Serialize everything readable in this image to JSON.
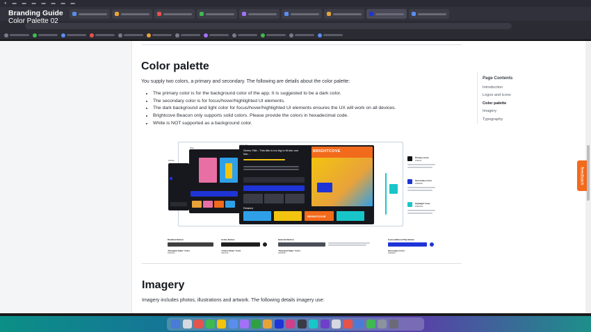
{
  "overlay": {
    "title": "Branding Guide",
    "subtitle": "Color Palette 02"
  },
  "colors": {
    "primary_dark": "#111111",
    "secondary_blue": "#1E34D6",
    "highlight_cyan": "#18C6C9",
    "brightcove_orange": "#F26A1B",
    "feedback_orange": "#F26A1B"
  },
  "main": {
    "heading": "Color palette",
    "intro": "You supply two colors, a primary and secondary. The following are details about the color palette:",
    "bullets": [
      "The primary color is for the background color of the app. It is suggested to be a dark color.",
      "The secondary color is for focus/hover/highlighted UI elements.",
      "The dark background and light color for focus/hover/highlighted UI elements ensures the UX will work on all devices.",
      "Brightcove Beacon only supports solid colors. Please provide the colors in hexadecimal code.",
      "White is NOT supported as a background color."
    ],
    "next_heading": "Imagery",
    "next_intro": "Imagery includes photos, illustrations and artwork. The following details imagery use:"
  },
  "toc": {
    "heading": "Page Contents",
    "items": [
      "Introduction",
      "Logos and icons",
      "Color palette",
      "Imagery",
      "Typography"
    ],
    "active_index": 2
  },
  "feedback": {
    "label": "feedback"
  },
  "figure": {
    "device_labels": [
      "Mobile",
      "Web",
      "Apple TV"
    ],
    "tv_title": "Series Title - This title is too big to fit into one line...",
    "tv_brand": "BRIGHTCOVE",
    "tv_section": "Related",
    "callouts": [
      {
        "title": "Primary Color",
        "hex": "#111111"
      },
      {
        "title": "Secondary Color",
        "hex": "#1E34D6"
      },
      {
        "title": "Highlight Color",
        "hex": "#18C6C9"
      }
    ],
    "button_states": [
      {
        "header": "Disabled Button",
        "label": "\"Disabled State\" Color",
        "hex": "#3F3F3F"
      },
      {
        "header": "Active Button",
        "label": "\"Active State\" Color",
        "hex": "#1F1F1F"
      },
      {
        "header": "Selected Button",
        "label": "\"Selected State\" Color",
        "hex": "#4A4F58"
      },
      {
        "header": "Focused/Hover/Tap Button",
        "label": "Secondary Color",
        "hex": "#1E34D6"
      }
    ]
  }
}
